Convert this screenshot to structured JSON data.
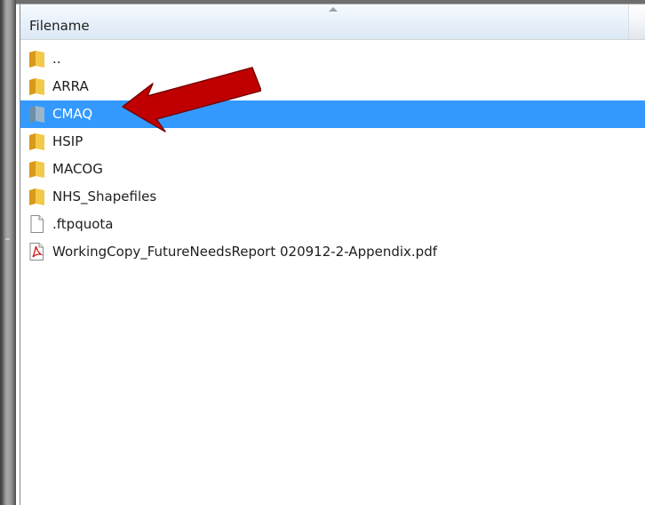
{
  "header": {
    "column_filename": "Filename"
  },
  "files": [
    {
      "name": "..",
      "icon": "folder-icon",
      "selected": false
    },
    {
      "name": "ARRA",
      "icon": "folder-icon",
      "selected": false
    },
    {
      "name": "CMAQ",
      "icon": "folder-icon",
      "selected": true
    },
    {
      "name": "HSIP",
      "icon": "folder-icon",
      "selected": false
    },
    {
      "name": "MACOG",
      "icon": "folder-icon",
      "selected": false
    },
    {
      "name": "NHS_Shapefiles",
      "icon": "folder-icon",
      "selected": false
    },
    {
      "name": ".ftpquota",
      "icon": "file-icon",
      "selected": false
    },
    {
      "name": "WorkingCopy_FutureNeedsReport 020912-2-Appendix.pdf",
      "icon": "pdf-icon",
      "selected": false
    }
  ],
  "colors": {
    "selection": "#3399ff",
    "annotation_arrow": "#c00000",
    "folder": "#e8b93a"
  }
}
